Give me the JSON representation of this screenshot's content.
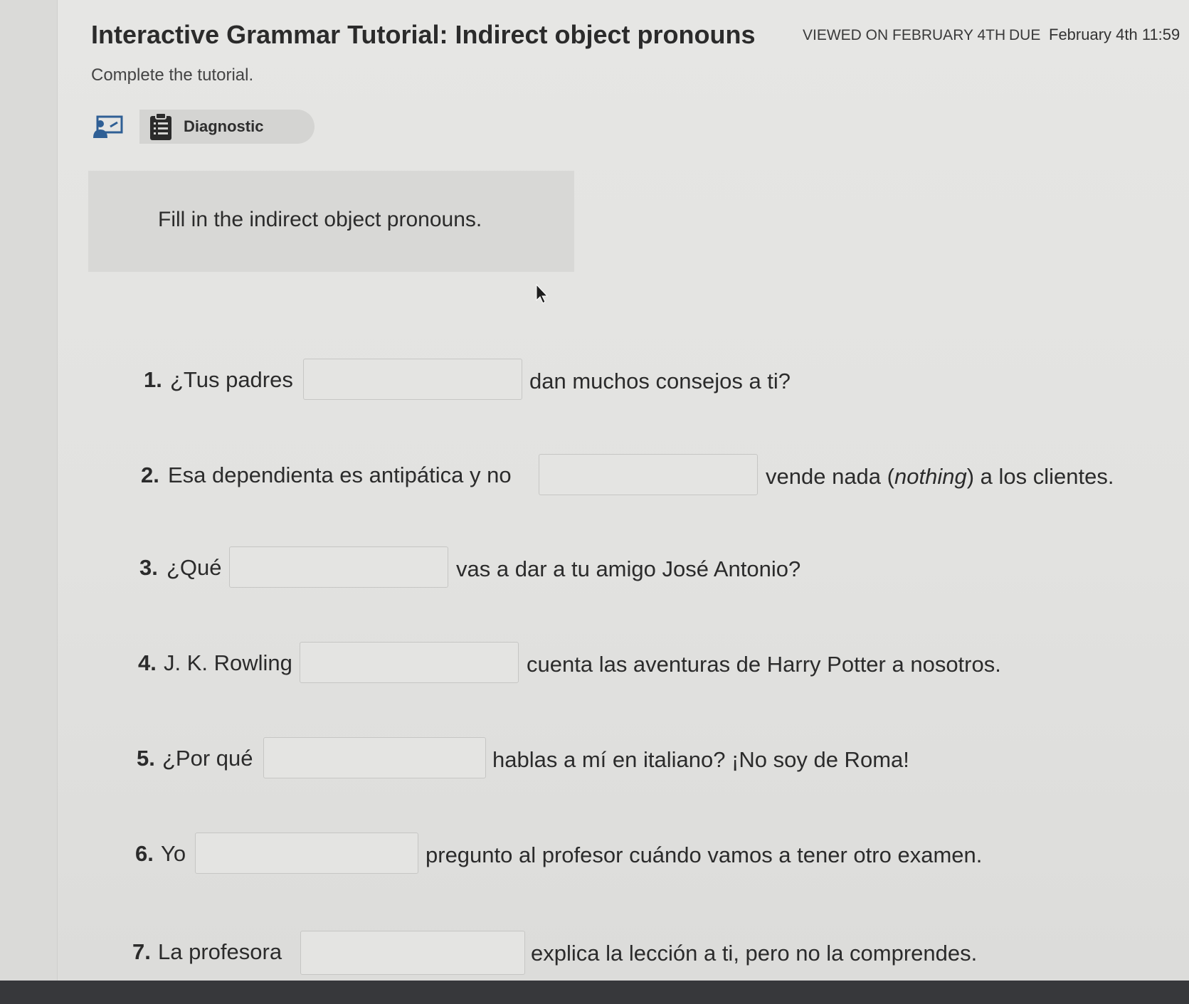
{
  "header": {
    "title": "Interactive Grammar Tutorial: Indirect object pronouns",
    "viewed": "VIEWED ON FEBRUARY 4TH",
    "due_label": "DUE",
    "due_date": "February 4th 11:59"
  },
  "instructions": "Complete the tutorial.",
  "toolbar": {
    "left_icon": "presentation-icon",
    "tab_icon": "clipboard-list-icon",
    "tab_label": "Diagnostic"
  },
  "prompt": "Fill in the indirect object pronouns.",
  "questions": [
    {
      "number": "1.",
      "before": "¿Tus padres",
      "value": "",
      "after": "dan muchos consejos a ti?"
    },
    {
      "number": "2.",
      "before": "Esa dependienta es antipática y no",
      "value": "",
      "after_pre": "vende nada (",
      "after_italic": "nothing",
      "after_post": ") a los clientes."
    },
    {
      "number": "3.",
      "before": "¿Qué",
      "value": "",
      "after": "vas a dar a tu amigo José Antonio?"
    },
    {
      "number": "4.",
      "before": "J. K. Rowling",
      "value": "",
      "after": "cuenta las aventuras de Harry Potter a nosotros."
    },
    {
      "number": "5.",
      "before": "¿Por qué",
      "value": "",
      "after": "hablas a mí en italiano? ¡No soy de Roma!"
    },
    {
      "number": "6.",
      "before": "Yo",
      "value": "",
      "after": "pregunto al profesor cuándo vamos a tener otro examen."
    },
    {
      "number": "7.",
      "before": "La profesora",
      "value": "",
      "after": "explica la lección a ti, pero no la comprendes."
    }
  ],
  "colors": {
    "background": "#e2e2e0",
    "prompt_box": "#d8d8d6",
    "accent_icon": "#2f5f95",
    "text": "#2b2b2b"
  }
}
